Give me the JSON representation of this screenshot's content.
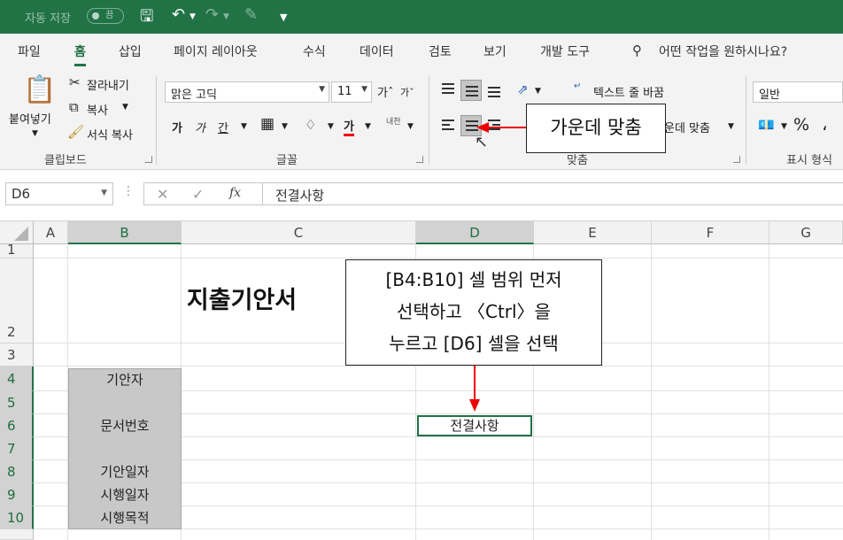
{
  "titlebar": {
    "autosave_label": "자동 저장",
    "autosave_state": "끔"
  },
  "ribbon_tabs": [
    "파일",
    "홈",
    "삽입",
    "페이지 레이아웃",
    "수식",
    "데이터",
    "검토",
    "보기",
    "개발 도구"
  ],
  "active_tab": "홈",
  "tell_me": "어떤 작업을 원하시나요?",
  "clipboard": {
    "paste": "붙여넣기",
    "cut": "잘라내기",
    "copy": "복사",
    "format_painter": "서식 복사",
    "group": "클립보드"
  },
  "font": {
    "name": "맑은 고딕",
    "size": "11",
    "bold": "가",
    "italic": "가",
    "underline": "간",
    "font_color": "가",
    "phonetic": "내천",
    "group": "글꼴"
  },
  "alignment": {
    "wrap_text": "텍스트 줄 바꿈",
    "merge_center": "병합하고 가운데 맞춤",
    "merge_center_visible": "운데 맞춤",
    "group": "맞춤"
  },
  "number": {
    "format": "일반",
    "percent": "%",
    "group": "표시 형식"
  },
  "callout_center": "가운데 맞춤",
  "callout_instruction": [
    "[B4:B10] 셀 범위 먼저",
    "선택하고 〈Ctrl〉을",
    "누르고 [D6] 셀을 선택"
  ],
  "formula_bar": {
    "name_box": "D6",
    "fx": "fx",
    "content": "전결사항"
  },
  "columns": [
    "A",
    "B",
    "C",
    "D",
    "E",
    "F",
    "G"
  ],
  "rows": [
    "1",
    "2",
    "3",
    "4",
    "5",
    "6",
    "7",
    "8",
    "9",
    "10"
  ],
  "cells": {
    "title": "지출기안서",
    "B4": "기안자",
    "B6": "문서번호",
    "B8": "기안일자",
    "B9": "시행일자",
    "B10": "시행목적",
    "D6": "전결사항"
  },
  "colors": {
    "excel_green": "#217346",
    "selection_gray": "#c8c8c8",
    "callout_red": "#e00000"
  }
}
